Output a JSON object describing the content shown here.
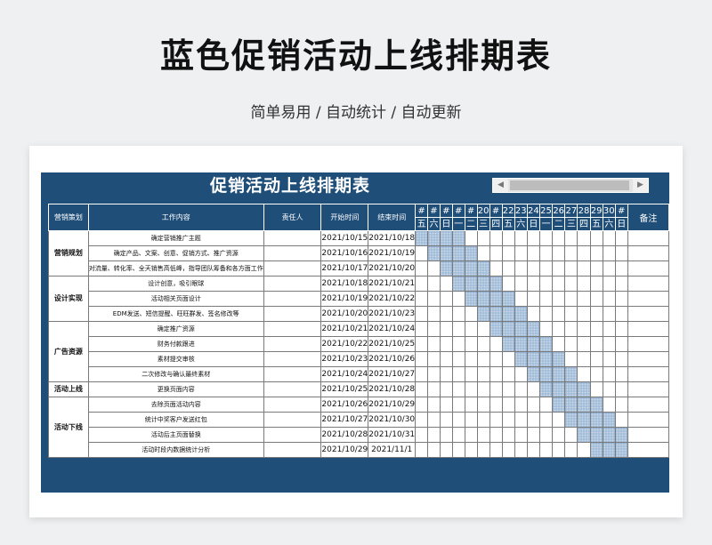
{
  "page": {
    "title": "蓝色促销活动上线排期表",
    "subtitle": "简单易用 / 自动统计 / 自动更新"
  },
  "sheet": {
    "title": "促销活动上线排期表",
    "headers": {
      "category": "营销策划",
      "content": "工作内容",
      "owner": "责任人",
      "start": "开始时间",
      "end": "结束时间",
      "notes": "备注"
    },
    "days": [
      "#",
      "#",
      "#",
      "#",
      "#",
      "20",
      "#",
      "22",
      "23",
      "24",
      "25",
      "26",
      "27",
      "28",
      "29",
      "30",
      "#"
    ],
    "weekdays": [
      "五",
      "六",
      "日",
      "一",
      "二",
      "三",
      "四",
      "五",
      "六",
      "日",
      "一",
      "二",
      "三",
      "四",
      "五",
      "六",
      "日"
    ],
    "groups": [
      {
        "name": "营销规划",
        "span": 3
      },
      {
        "name": "设计实现",
        "span": 3
      },
      {
        "name": "广告资源",
        "span": 4
      },
      {
        "name": "活动上线",
        "span": 1
      },
      {
        "name": "活动下线",
        "span": 4
      }
    ],
    "rows": [
      {
        "task": "确定营销推广主题",
        "owner": "",
        "start": "2021/10/15",
        "end": "2021/10/18",
        "bar": [
          0,
          3
        ]
      },
      {
        "task": "确定产品、文案、创意、促销方式、推广资源",
        "owner": "",
        "start": "2021/10/16",
        "end": "2021/10/19",
        "bar": [
          1,
          4
        ]
      },
      {
        "task": "对流量、转化率、全天销售高低峰，指导团队筹备和各方面工作",
        "owner": "",
        "start": "2021/10/17",
        "end": "2021/10/20",
        "bar": [
          2,
          5
        ]
      },
      {
        "task": "设计创意，吸引眼球",
        "owner": "",
        "start": "2021/10/18",
        "end": "2021/10/21",
        "bar": [
          3,
          6
        ]
      },
      {
        "task": "活动相关页面设计",
        "owner": "",
        "start": "2021/10/19",
        "end": "2021/10/22",
        "bar": [
          4,
          7
        ]
      },
      {
        "task": "EDM发送、短信提醒、旺旺群发、签名修改等",
        "owner": "",
        "start": "2021/10/20",
        "end": "2021/10/23",
        "bar": [
          5,
          8
        ]
      },
      {
        "task": "确定推广资源",
        "owner": "",
        "start": "2021/10/21",
        "end": "2021/10/24",
        "bar": [
          6,
          9
        ]
      },
      {
        "task": "财务付款跟进",
        "owner": "",
        "start": "2021/10/22",
        "end": "2021/10/25",
        "bar": [
          7,
          10
        ]
      },
      {
        "task": "素材提交审核",
        "owner": "",
        "start": "2021/10/23",
        "end": "2021/10/26",
        "bar": [
          8,
          11
        ]
      },
      {
        "task": "二次修改与确认最终素材",
        "owner": "",
        "start": "2021/10/24",
        "end": "2021/10/27",
        "bar": [
          9,
          12
        ]
      },
      {
        "task": "更换页面内容",
        "owner": "",
        "start": "2021/10/25",
        "end": "2021/10/28",
        "bar": [
          10,
          13
        ]
      },
      {
        "task": "去除页面活动内容",
        "owner": "",
        "start": "2021/10/26",
        "end": "2021/10/29",
        "bar": [
          11,
          14
        ]
      },
      {
        "task": "统计中奖客户发送红包",
        "owner": "",
        "start": "2021/10/27",
        "end": "2021/10/30",
        "bar": [
          12,
          15
        ]
      },
      {
        "task": "活动后主页面替换",
        "owner": "",
        "start": "2021/10/28",
        "end": "2021/10/31",
        "bar": [
          13,
          16
        ]
      },
      {
        "task": "活动时段内数据统计分析",
        "owner": "",
        "start": "2021/10/29",
        "end": "2021/11/1",
        "bar": [
          14,
          16
        ]
      }
    ],
    "colors": {
      "header": "#1f4e79",
      "bar": "#c6d8ea"
    }
  }
}
